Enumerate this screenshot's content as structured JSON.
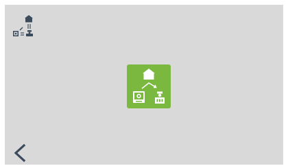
{
  "colors": {
    "screen_background": "#d9d9d9",
    "tile_green": "#7ab83f",
    "tile_icon": "#ffffff",
    "status_icon": "#3c4b5c",
    "back_arrow": "#3c4b5c"
  },
  "status_indicator": {
    "icon": "home-camera-intercom-topology-icon"
  },
  "mode_tile": {
    "icon": "home-to-camera-and-intercom-icon"
  },
  "back": {
    "icon": "chevron-left-icon"
  }
}
